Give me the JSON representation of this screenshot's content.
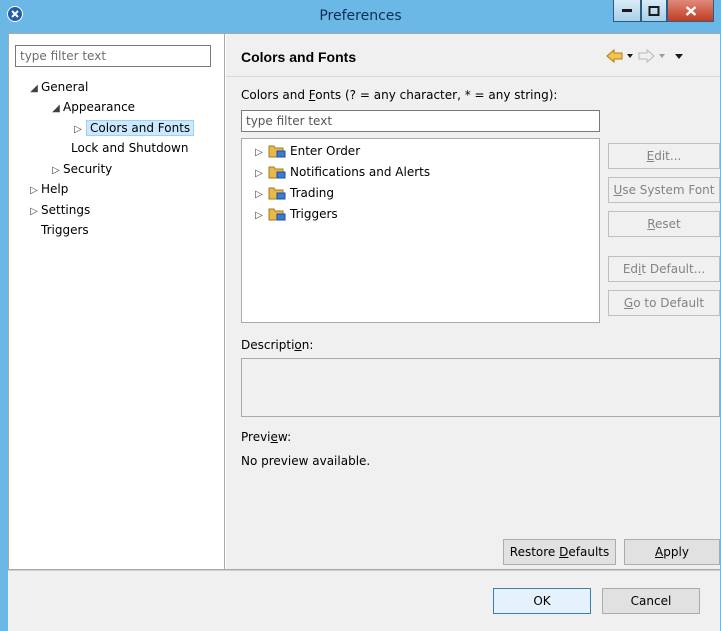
{
  "window": {
    "title": "Preferences"
  },
  "left": {
    "filter_placeholder": "type filter text",
    "tree": [
      {
        "label": "General",
        "state": "expanded"
      },
      {
        "label": "Appearance",
        "state": "expanded"
      },
      {
        "label": "Colors and Fonts",
        "state": "collapsed",
        "selected": true
      },
      {
        "label": "Lock and Shutdown",
        "state": "leaf"
      },
      {
        "label": "Security",
        "state": "collapsed"
      },
      {
        "label": "Help",
        "state": "collapsed"
      },
      {
        "label": "Settings",
        "state": "collapsed"
      },
      {
        "label": "Triggers",
        "state": "leaf"
      }
    ]
  },
  "page": {
    "title": "Colors and Fonts",
    "filter_label_pre": "Colors and ",
    "filter_label_mnemonic": "F",
    "filter_label_post": "onts (? = any character, * = any string):",
    "filter_placeholder": "type filter text",
    "list": [
      "Enter Order",
      "Notifications and Alerts",
      "Trading",
      "Triggers"
    ],
    "buttons": {
      "edit": {
        "pre": "",
        "mn": "E",
        "post": "dit..."
      },
      "use_system_font": {
        "pre": "",
        "mn": "U",
        "post": "se System Font"
      },
      "reset": {
        "pre": "",
        "mn": "R",
        "post": "eset"
      },
      "edit_default": {
        "pre": "Ed",
        "mn": "i",
        "post": "t Default..."
      },
      "go_to_default": {
        "pre": "",
        "mn": "G",
        "post": "o to Default"
      }
    },
    "description_label": {
      "pre": "Descripti",
      "mn": "o",
      "post": "n:"
    },
    "preview_label": {
      "pre": "Previ",
      "mn": "e",
      "post": "w:"
    },
    "preview_text": "No preview available.",
    "restore_defaults": {
      "pre": "Restore ",
      "mn": "D",
      "post": "efaults"
    },
    "apply": {
      "pre": "",
      "mn": "A",
      "post": "pply"
    }
  },
  "footer": {
    "ok": "OK",
    "cancel": "Cancel"
  },
  "colors": {
    "titlebar": "#6bb8e6",
    "selection": "#cce8ff",
    "nav_arrow": "#f0b030"
  }
}
